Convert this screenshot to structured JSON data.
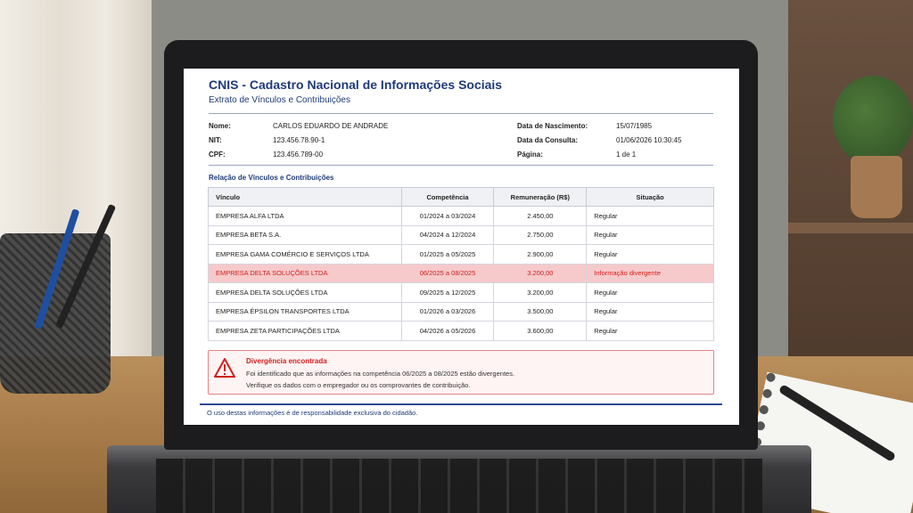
{
  "header": {
    "title": "CNIS - Cadastro Nacional de Informações Sociais",
    "subtitle": "Extrato de Vínculos e Contribuições"
  },
  "person": {
    "name_label": "Nome:",
    "name_value": "CARLOS EDUARDO DE ANDRADE",
    "nit_label": "NIT:",
    "nit_value": "123.456.78.90-1",
    "cpf_label": "CPF:",
    "cpf_value": "123.456.789-00",
    "birth_label": "Data de Nascimento:",
    "birth_value": "15/07/1985",
    "query_label": "Data da Consulta:",
    "query_value": "01/06/2026 10:30:45",
    "page_label": "Página:",
    "page_value": "1 de 1"
  },
  "section_title": "Relação de Vínculos e Contribuições",
  "table": {
    "columns": [
      "Vínculo",
      "Competência",
      "Remuneração (R$)",
      "Situação"
    ],
    "rows": [
      [
        "EMPRESA ALFA LTDA",
        "01/2024 a 03/2024",
        "2.450,00",
        "Regular"
      ],
      [
        "EMPRESA BETA S.A.",
        "04/2024 a 12/2024",
        "2.750,00",
        "Regular"
      ],
      [
        "EMPRESA GAMA COMÉRCIO E SERVIÇOS LTDA",
        "01/2025 a 05/2025",
        "2.900,00",
        "Regular"
      ],
      [
        "EMPRESA DELTA SOLUÇÕES LTDA",
        "06/2025 a 08/2025",
        "3.200,00",
        "Informação divergente"
      ],
      [
        "EMPRESA DELTA SOLUÇÕES LTDA",
        "09/2025 a 12/2025",
        "3.200,00",
        "Regular"
      ],
      [
        "EMPRESA ÉPSILON TRANSPORTES LTDA",
        "01/2026 a 03/2026",
        "3.500,00",
        "Regular"
      ],
      [
        "EMPRESA ZETA PARTICIPAÇÕES LTDA",
        "04/2026 a 05/2026",
        "3.600,00",
        "Regular"
      ]
    ],
    "highlight_row": 3,
    "highlight_color": "#f6c9ca",
    "highlight_text_color": "#d22020"
  },
  "alert": {
    "icon": "warning-triangle-icon",
    "title": "Divergência encontrada",
    "line1": "Foi identificado que as informações na competência 06/2025 a 08/2025 estão divergentes.",
    "line2": "Verifique os dados com o empregador ou os comprovantes de contribuição."
  },
  "footer": "O uso destas informações é de responsabilidade exclusiva do cidadão.",
  "colors": {
    "brand": "#1f3a7a",
    "alert": "#d22020"
  }
}
